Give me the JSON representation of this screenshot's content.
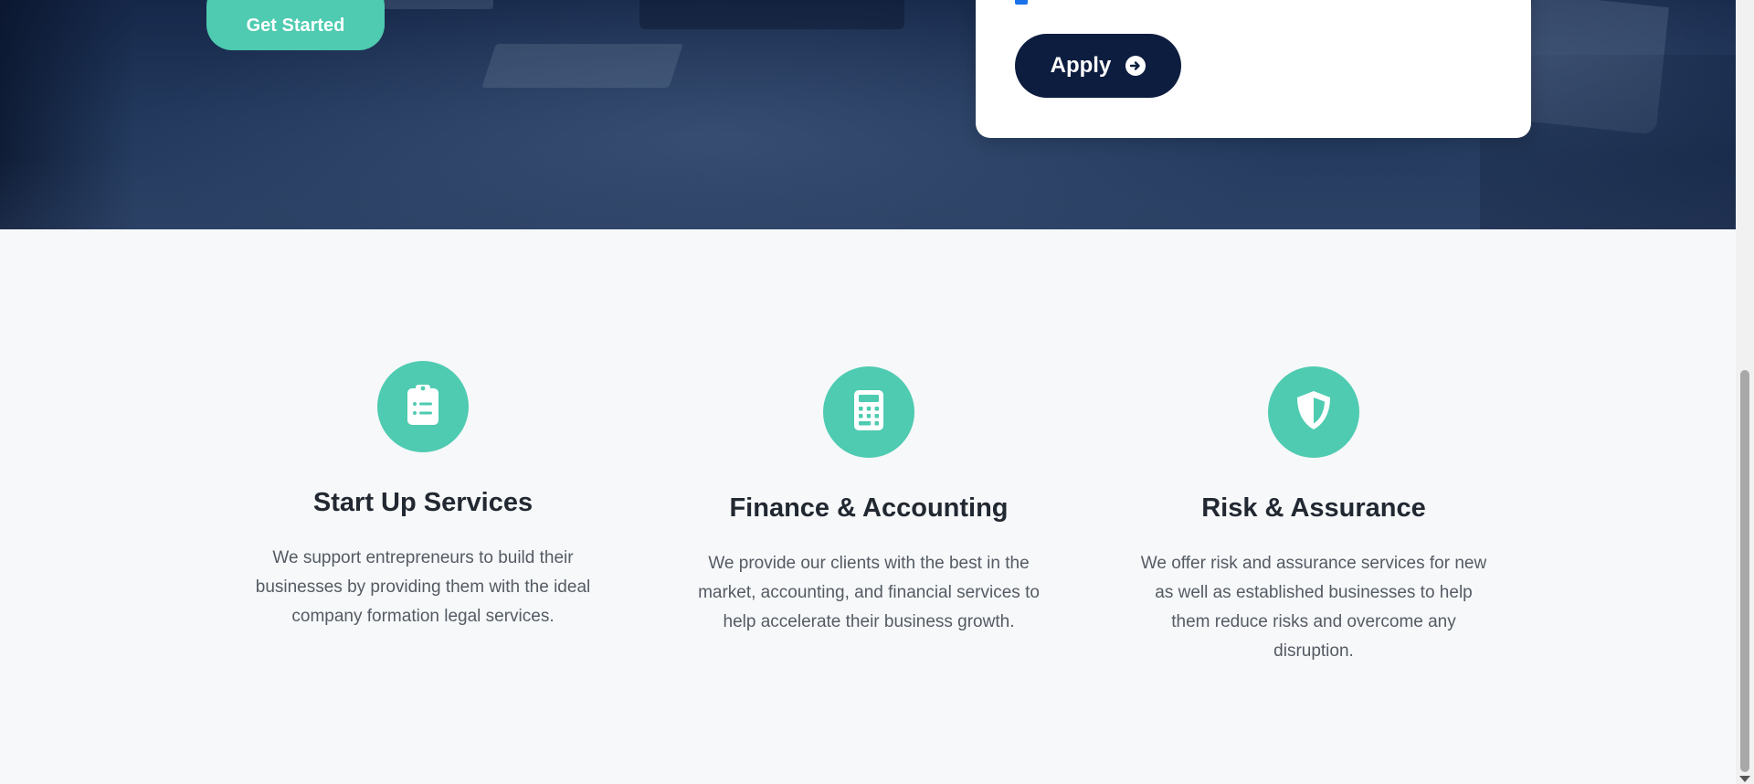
{
  "hero": {
    "get_started_label": "Get Started"
  },
  "form": {
    "checkbox_label": "",
    "apply_label": "Apply"
  },
  "services": [
    {
      "icon": "clipboard-list-icon",
      "title": "Start Up Services",
      "description": "We support entrepreneurs to build their businesses by providing them with the ideal company formation legal services."
    },
    {
      "icon": "calculator-icon",
      "title": "Finance & Accounting",
      "description": "We provide our clients with the best in the market, accounting, and financial services to help accelerate their business growth."
    },
    {
      "icon": "shield-icon",
      "title": "Risk & Assurance",
      "description": "We offer risk and assurance services for new as well as established businesses to help them reduce risks and overcome any disruption."
    }
  ],
  "colors": {
    "accent": "#4ecbb0",
    "navy": "#0d1d3f",
    "heading": "#222831",
    "body_text": "#555b63",
    "section_bg": "#f6f8fa"
  }
}
